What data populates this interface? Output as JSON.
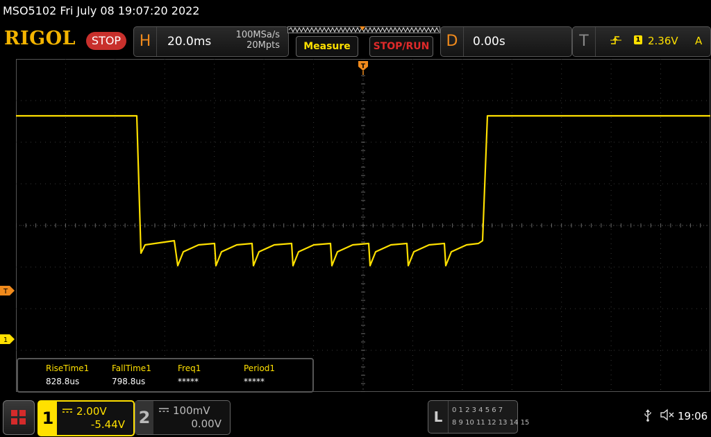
{
  "title_bar": {
    "text": "MSO5102  Fri July 08 19:07:20 2022"
  },
  "header": {
    "logo": "RIGOL",
    "run_status": "STOP",
    "horizontal": {
      "letter": "H",
      "timebase": "20.0ms",
      "sample_rate": "100MSa/s",
      "memory_depth": "20Mpts"
    },
    "measure_label": "Measure",
    "stop_run_label": "STOP/RUN",
    "delay": {
      "letter": "D",
      "value": "0.00s"
    },
    "trigger": {
      "letter": "T",
      "edge_icon": "rising-edge-icon",
      "source": "1",
      "level": "2.36V",
      "mode": "A"
    }
  },
  "display": {
    "grid_divisions": {
      "horizontal": 14,
      "vertical": 8
    },
    "trace_color": "#ffe000",
    "trigger_marker_label": "T",
    "ch1_marker_label": "1",
    "trigger_position_marker": "T"
  },
  "measurements": [
    {
      "name": "RiseTime1",
      "value": "828.8us"
    },
    {
      "name": "FallTime1",
      "value": "798.8us"
    },
    {
      "name": "Freq1",
      "value": "*****"
    },
    {
      "name": "Period1",
      "value": "*****"
    }
  ],
  "channels": {
    "ch1": {
      "number": "1",
      "coupling_icon": "dc-coupling-icon",
      "scale": "2.00V",
      "offset": "-5.44V",
      "color": "#ffe000"
    },
    "ch2": {
      "number": "2",
      "coupling_icon": "dc-coupling-icon",
      "scale": "100mV",
      "offset": "0.00V",
      "color": "#bbbbbb"
    }
  },
  "logic": {
    "letter": "L",
    "row1": "0 1 2 3  4 5 6 7",
    "row2": "8 9 10 11 12 13 14 15"
  },
  "status": {
    "usb_icon": "usb-icon",
    "speaker_icon": "speaker-muted-icon",
    "time": "19:06"
  },
  "colors": {
    "accent": "#f08a1c",
    "stop_red": "#c8302c",
    "logo": "#f3b400"
  }
}
